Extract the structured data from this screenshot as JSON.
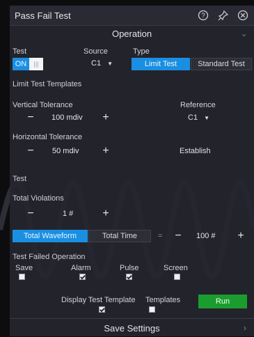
{
  "window": {
    "title": "Pass Fail Test"
  },
  "icons": {
    "help": "help-circle-icon",
    "pin": "pin-icon",
    "close": "close-circle-icon"
  },
  "operation": {
    "header": "Operation",
    "test_label": "Test",
    "toggle_on": "ON",
    "source_label": "Source",
    "source_value": "C1",
    "type_label": "Type",
    "type_options": [
      "Limit Test",
      "Standard Test"
    ],
    "type_selected": "Limit Test"
  },
  "templates": {
    "header": "Limit Test Templates",
    "vertical_label": "Vertical Tolerance",
    "vertical_value": "100 mdiv",
    "reference_label": "Reference",
    "reference_value": "C1",
    "horizontal_label": "Horizontal Tolerance",
    "horizontal_value": "50 mdiv",
    "establish": "Establish"
  },
  "test": {
    "header": "Test",
    "violations_label": "Total Violations",
    "violations_value": "1 #",
    "mode_options": [
      "Total Waveform",
      "Total Time"
    ],
    "mode_selected": "Total Waveform",
    "equals": "=",
    "count_value": "100 #"
  },
  "failed": {
    "header": "Test Failed Operation",
    "items": [
      {
        "label": "Save",
        "checked": false
      },
      {
        "label": "Alarm",
        "checked": true
      },
      {
        "label": "Pulse",
        "checked": true
      },
      {
        "label": "Screen",
        "checked": false
      }
    ],
    "display_label": "Display Test Template",
    "display_checked": true,
    "templates_label": "Templates",
    "templates_checked": false,
    "run": "Run"
  },
  "save_settings": {
    "header": "Save Settings"
  },
  "stepper": {
    "minus": "−",
    "plus": "+"
  },
  "colors": {
    "accent": "#1a8fe2",
    "run": "#1b9c2f",
    "panel": "#262630"
  }
}
